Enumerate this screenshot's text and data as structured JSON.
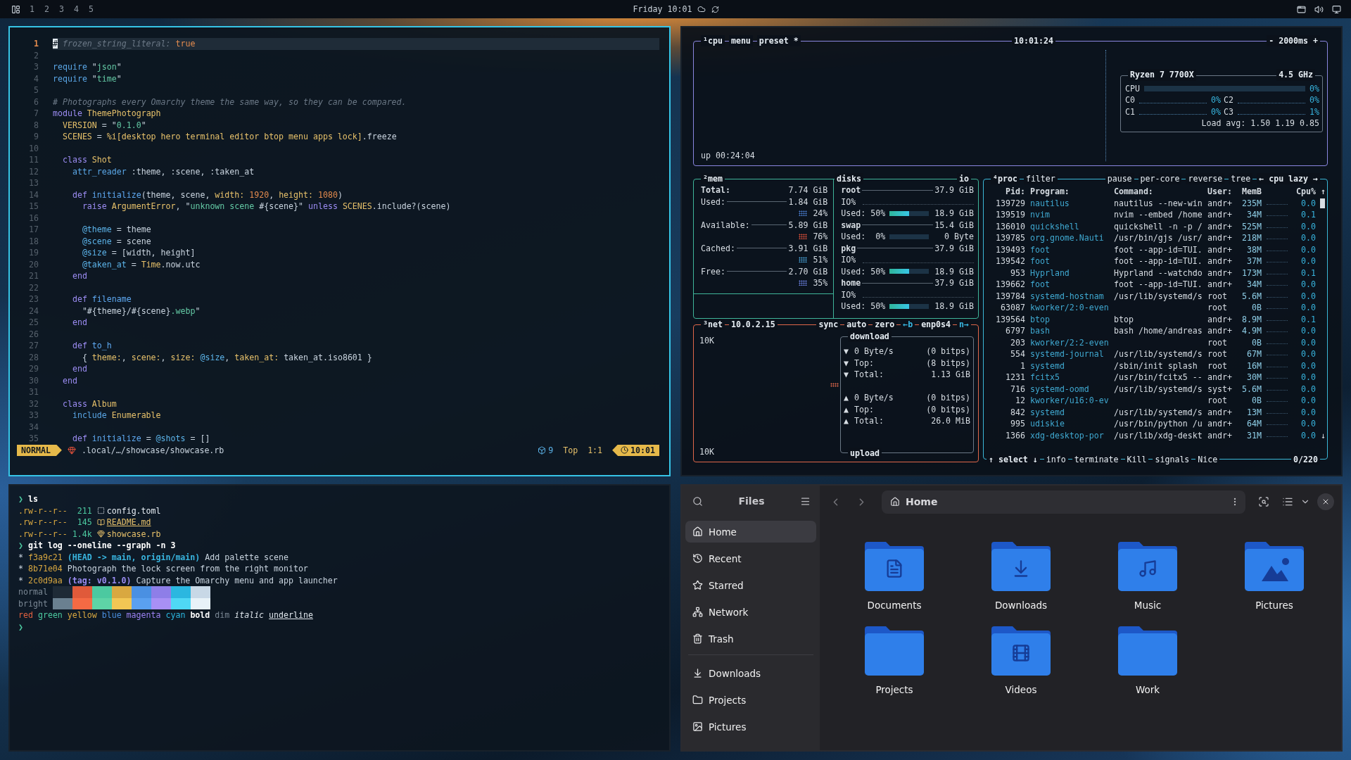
{
  "topbar": {
    "workspaces": [
      "1",
      "2",
      "3",
      "4",
      "5"
    ],
    "clock": "Friday 10:01"
  },
  "editor": {
    "lines": [
      {
        "number": "1",
        "current": true,
        "code": [
          {
            "text": "#",
            "kind": "cursor"
          },
          {
            "text": " frozen_string_literal:",
            "kind": "comment"
          },
          {
            "text": " true",
            "kind": "num"
          }
        ]
      },
      {
        "number": "2",
        "current": false
      },
      {
        "number": "3",
        "current": false,
        "code": [
          {
            "text": "require",
            "kind": "call"
          },
          {
            "text": " \"",
            "kind": "plain"
          },
          {
            "text": "json",
            "kind": "str"
          },
          {
            "text": "\"",
            "kind": "plain"
          }
        ]
      },
      {
        "number": "4",
        "current": false,
        "code": [
          {
            "text": "require",
            "kind": "call"
          },
          {
            "text": " \"",
            "kind": "plain"
          },
          {
            "text": "time",
            "kind": "str"
          },
          {
            "text": "\"",
            "kind": "plain"
          }
        ]
      },
      {
        "number": "5",
        "current": false
      },
      {
        "number": "6",
        "current": false,
        "code": [
          {
            "text": "# Photographs every Omarchy theme the same way, so they can be compared.",
            "kind": "comment"
          }
        ]
      },
      {
        "number": "7",
        "current": false,
        "code": [
          {
            "text": "module",
            "kind": "kw"
          },
          {
            "text": " ThemePhotograph",
            "kind": "const"
          }
        ]
      },
      {
        "number": "8",
        "current": false,
        "code": [
          {
            "text": "  VERSION",
            "kind": "const"
          },
          {
            "text": " = \"",
            "kind": "plain"
          },
          {
            "text": "0.1.0",
            "kind": "str"
          },
          {
            "text": "\"",
            "kind": "plain"
          }
        ]
      },
      {
        "number": "9",
        "current": false,
        "code": [
          {
            "text": "  SCENES",
            "kind": "const"
          },
          {
            "text": " = ",
            "kind": "plain"
          },
          {
            "text": "%i[desktop hero terminal editor btop menu apps lock]",
            "kind": "const"
          },
          {
            "text": ".freeze",
            "kind": "plain"
          }
        ]
      },
      {
        "number": "10",
        "current": false
      },
      {
        "number": "11",
        "current": false,
        "code": [
          {
            "text": "  class",
            "kind": "kw"
          },
          {
            "text": " Shot",
            "kind": "const"
          }
        ]
      },
      {
        "number": "12",
        "current": false,
        "code": [
          {
            "text": "    attr_reader",
            "kind": "call"
          },
          {
            "text": " :theme, :scene, :taken_at",
            "kind": "plain"
          }
        ]
      },
      {
        "number": "13",
        "current": false
      },
      {
        "number": "14",
        "current": false,
        "code": [
          {
            "text": "    def",
            "kind": "kw"
          },
          {
            "text": " initialize",
            "kind": "fn"
          },
          {
            "text": "(theme, scene, ",
            "kind": "plain"
          },
          {
            "text": "width:",
            "kind": "const"
          },
          {
            "text": " 1920",
            "kind": "num"
          },
          {
            "text": ", ",
            "kind": "plain"
          },
          {
            "text": "height:",
            "kind": "const"
          },
          {
            "text": " 1080",
            "kind": "num"
          },
          {
            "text": ")",
            "kind": "plain"
          }
        ]
      },
      {
        "number": "15",
        "current": false,
        "code": [
          {
            "text": "      raise",
            "kind": "kw"
          },
          {
            "text": " ArgumentError",
            "kind": "const"
          },
          {
            "text": ", \"",
            "kind": "plain"
          },
          {
            "text": "unknown scene ",
            "kind": "str"
          },
          {
            "text": "#{scene}\"",
            "kind": "plain"
          },
          {
            "text": " unless",
            "kind": "kw"
          },
          {
            "text": " SCENES",
            "kind": "const"
          },
          {
            "text": ".include?(scene)",
            "kind": "plain"
          }
        ]
      },
      {
        "number": "16",
        "current": false
      },
      {
        "number": "17",
        "current": false,
        "code": [
          {
            "text": "      @theme",
            "kind": "ivar"
          },
          {
            "text": " = theme",
            "kind": "plain"
          }
        ]
      },
      {
        "number": "18",
        "current": false,
        "code": [
          {
            "text": "      @scene",
            "kind": "ivar"
          },
          {
            "text": " = scene",
            "kind": "plain"
          }
        ]
      },
      {
        "number": "19",
        "current": false,
        "code": [
          {
            "text": "      @size",
            "kind": "ivar"
          },
          {
            "text": " = [width, height]",
            "kind": "plain"
          }
        ]
      },
      {
        "number": "20",
        "current": false,
        "code": [
          {
            "text": "      @taken_at",
            "kind": "ivar"
          },
          {
            "text": " = ",
            "kind": "plain"
          },
          {
            "text": "Time",
            "kind": "const"
          },
          {
            "text": ".now.utc",
            "kind": "plain"
          }
        ]
      },
      {
        "number": "21",
        "current": false,
        "code": [
          {
            "text": "    end",
            "kind": "kw"
          }
        ]
      },
      {
        "number": "22",
        "current": false
      },
      {
        "number": "23",
        "current": false,
        "code": [
          {
            "text": "    def",
            "kind": "kw"
          },
          {
            "text": " filename",
            "kind": "fn"
          }
        ]
      },
      {
        "number": "24",
        "current": false,
        "code": [
          {
            "text": "      \"#{theme}/#{scene}",
            "kind": "plain"
          },
          {
            "text": ".webp",
            "kind": "str"
          },
          {
            "text": "\"",
            "kind": "plain"
          }
        ]
      },
      {
        "number": "25",
        "current": false,
        "code": [
          {
            "text": "    end",
            "kind": "kw"
          }
        ]
      },
      {
        "number": "26",
        "current": false
      },
      {
        "number": "27",
        "current": false,
        "code": [
          {
            "text": "    def",
            "kind": "kw"
          },
          {
            "text": " to_h",
            "kind": "fn"
          }
        ]
      },
      {
        "number": "28",
        "current": false,
        "code": [
          {
            "text": "      { ",
            "kind": "plain"
          },
          {
            "text": "theme:",
            "kind": "const"
          },
          {
            "text": ", ",
            "kind": "plain"
          },
          {
            "text": "scene:",
            "kind": "const"
          },
          {
            "text": ", ",
            "kind": "plain"
          },
          {
            "text": "size:",
            "kind": "const"
          },
          {
            "text": " @size",
            "kind": "ivar"
          },
          {
            "text": ", ",
            "kind": "plain"
          },
          {
            "text": "taken_at:",
            "kind": "const"
          },
          {
            "text": " taken_at.iso8601 }",
            "kind": "plain"
          }
        ]
      },
      {
        "number": "29",
        "current": false,
        "code": [
          {
            "text": "    end",
            "kind": "kw"
          }
        ]
      },
      {
        "number": "30",
        "current": false,
        "code": [
          {
            "text": "  end",
            "kind": "kw"
          }
        ]
      },
      {
        "number": "31",
        "current": false
      },
      {
        "number": "32",
        "current": false,
        "code": [
          {
            "text": "  class",
            "kind": "kw"
          },
          {
            "text": " Album",
            "kind": "const"
          }
        ]
      },
      {
        "number": "33",
        "current": false,
        "code": [
          {
            "text": "    include",
            "kind": "call"
          },
          {
            "text": " Enumerable",
            "kind": "const"
          }
        ]
      },
      {
        "number": "34",
        "current": false
      },
      {
        "number": "35",
        "current": false,
        "code": [
          {
            "text": "    def",
            "kind": "kw"
          },
          {
            "text": " initialize",
            "kind": "fn"
          },
          {
            "text": " = ",
            "kind": "plain"
          },
          {
            "text": "@shots",
            "kind": "ivar"
          },
          {
            "text": " = []",
            "kind": "plain"
          }
        ]
      }
    ],
    "status": {
      "mode": "NORMAL",
      "path": ".local/…/showcase/showcase.rb",
      "diagnostics": "9",
      "position": "Top",
      "cursor": "1:1",
      "time": "10:01"
    }
  },
  "btop": {
    "cpu": {
      "titles": [
        "¹cpu",
        "menu",
        "preset *"
      ],
      "clock": "10:01:24",
      "interval": "- 2000ms +",
      "uptime": "up 00:24:04",
      "model": "Ryzen 7 7700X",
      "frequency": "4.5 GHz",
      "total": {
        "label": "CPU",
        "level": 0,
        "reading": "0%"
      },
      "cores": [
        {
          "label": "C0",
          "reading": "0%"
        },
        {
          "label": "C2",
          "reading": "0%"
        },
        {
          "label": "C1",
          "reading": "0%"
        },
        {
          "label": "C3",
          "reading": "1%"
        }
      ],
      "load": "Load avg: 1.50 1.19 0.85"
    },
    "mem": {
      "title": "²mem",
      "rows": [
        {
          "label": "Total:",
          "value": "7.74 GiB"
        },
        {
          "label": "Used:",
          "value": "1.84 GiB",
          "percent": "24%",
          "color": "#4a7fd4"
        },
        {
          "label": "Available:",
          "value": "5.89 GiB",
          "percent": "76%",
          "color": "#e0503a"
        },
        {
          "label": "Cached:",
          "value": "3.91 GiB",
          "percent": "51%",
          "color": "#4aa8e0"
        },
        {
          "label": "Free:",
          "value": "2.70 GiB",
          "percent": "35%",
          "color": "#6a80e0"
        }
      ]
    },
    "disks": {
      "title": "disks",
      "io_title": "io",
      "items": [
        {
          "name": "root",
          "size": "37.9 GiB",
          "io": "IO%",
          "used_label": "Used: 50%",
          "level": 0.5,
          "used": "18.9 GiB"
        },
        {
          "name": "swap",
          "size": "15.4 GiB",
          "used_label": "Used:  0%",
          "level": 0,
          "used": "0 Byte"
        },
        {
          "name": "pkg",
          "size": "37.9 GiB",
          "io": "IO%",
          "used_label": "Used: 50%",
          "level": 0.5,
          "used": "18.9 GiB"
        },
        {
          "name": "home",
          "size": "37.9 GiB",
          "io": "IO%",
          "used_label": "Used: 50%",
          "level": 0.5,
          "used": "18.9 GiB"
        }
      ]
    },
    "net": {
      "title": "³net",
      "address": "10.0.2.15",
      "toggles": [
        "sync",
        "auto",
        "zero"
      ],
      "interface": [
        "←b",
        "enp0s4",
        "n→"
      ],
      "scale_top": "10K",
      "scale_bottom": "10K",
      "download": {
        "title": "download",
        "rows": [
          {
            "arrow": "▼",
            "label": "0 Byte/s",
            "value": "(0 bitps)"
          },
          {
            "arrow": "▼",
            "label": "Top:",
            "value": "(8 bitps)"
          },
          {
            "arrow": "▼",
            "label": "Total:",
            "value": "1.13 GiB"
          }
        ]
      },
      "upload": {
        "title": "upload",
        "rows": [
          {
            "arrow": "▲",
            "label": "0 Byte/s",
            "value": "(0 bitps)"
          },
          {
            "arrow": "▲",
            "label": "Top:",
            "value": "(0 bitps)"
          },
          {
            "arrow": "▲",
            "label": "Total:",
            "value": "26.0 MiB"
          }
        ]
      }
    },
    "proc": {
      "title": "⁴proc",
      "filter": "filter",
      "options": [
        "pause",
        "per-core",
        "reverse",
        "tree"
      ],
      "sort": "← cpu lazy →",
      "columns": [
        "Pid:",
        "Program:",
        "Command:",
        "User:",
        "MemB",
        "Cpu%"
      ],
      "sort_arrow": "↑",
      "scroll_down": "↓",
      "rows": [
        {
          "pid": "139729",
          "program": "nautilus",
          "command": "nautilus --new-win",
          "user": "andr+",
          "mem": "235M",
          "cpu": "0.0"
        },
        {
          "pid": "139519",
          "program": "nvim",
          "command": "nvim --embed /home",
          "user": "andr+",
          "mem": "34M",
          "cpu": "0.1"
        },
        {
          "pid": "136010",
          "program": "quickshell",
          "command": "quickshell -n -p /",
          "user": "andr+",
          "mem": "525M",
          "cpu": "0.0"
        },
        {
          "pid": "139785",
          "program": "org.gnome.Nauti",
          "command": "/usr/bin/gjs /usr/",
          "user": "andr+",
          "mem": "218M",
          "cpu": "0.0"
        },
        {
          "pid": "139493",
          "program": "foot",
          "command": "foot --app-id=TUI.",
          "user": "andr+",
          "mem": "38M",
          "cpu": "0.0"
        },
        {
          "pid": "139542",
          "program": "foot",
          "command": "foot --app-id=TUI.",
          "user": "andr+",
          "mem": "37M",
          "cpu": "0.0"
        },
        {
          "pid": "953",
          "program": "Hyprland",
          "command": "Hyprland --watchdo",
          "user": "andr+",
          "mem": "173M",
          "cpu": "0.1"
        },
        {
          "pid": "139662",
          "program": "foot",
          "command": "foot --app-id=TUI.",
          "user": "andr+",
          "mem": "34M",
          "cpu": "0.0"
        },
        {
          "pid": "139784",
          "program": "systemd-hostnam",
          "command": "/usr/lib/systemd/s",
          "user": "root",
          "mem": "5.6M",
          "cpu": "0.0"
        },
        {
          "pid": "63087",
          "program": "kworker/2:0-even",
          "user": "root",
          "mem": "0B",
          "cpu": "0.0"
        },
        {
          "pid": "139564",
          "program": "btop",
          "command": "btop",
          "user": "andr+",
          "mem": "8.9M",
          "cpu": "0.1"
        },
        {
          "pid": "6797",
          "program": "bash",
          "command": "bash /home/andreas",
          "user": "andr+",
          "mem": "4.9M",
          "cpu": "0.0"
        },
        {
          "pid": "203",
          "program": "kworker/2:2-even",
          "user": "root",
          "mem": "0B",
          "cpu": "0.0"
        },
        {
          "pid": "554",
          "program": "systemd-journal",
          "command": "/usr/lib/systemd/s",
          "user": "root",
          "mem": "67M",
          "cpu": "0.0"
        },
        {
          "pid": "1",
          "program": "systemd",
          "command": "/sbin/init splash",
          "user": "root",
          "mem": "16M",
          "cpu": "0.0"
        },
        {
          "pid": "1231",
          "program": "fcitx5",
          "command": "/usr/bin/fcitx5 --",
          "user": "andr+",
          "mem": "30M",
          "cpu": "0.0"
        },
        {
          "pid": "716",
          "program": "systemd-oomd",
          "command": "/usr/lib/systemd/s",
          "user": "syst+",
          "mem": "5.6M",
          "cpu": "0.0"
        },
        {
          "pid": "12",
          "program": "kworker/u16:0-ev",
          "user": "root",
          "mem": "0B",
          "cpu": "0.0"
        },
        {
          "pid": "842",
          "program": "systemd",
          "command": "/usr/lib/systemd/s",
          "user": "andr+",
          "mem": "13M",
          "cpu": "0.0"
        },
        {
          "pid": "995",
          "program": "udiskie",
          "command": "/usr/bin/python /u",
          "user": "andr+",
          "mem": "64M",
          "cpu": "0.0"
        },
        {
          "pid": "1366",
          "program": "xdg-desktop-por",
          "command": "/usr/lib/xdg-deskt",
          "user": "andr+",
          "mem": "31M",
          "cpu": "0.0"
        }
      ],
      "footer": [
        "↑ select ↓",
        "info",
        "terminate",
        "Kill",
        "signals",
        "Nice"
      ],
      "count": "0/220"
    }
  },
  "terminal": {
    "lines": [
      {
        "kind": "prompt",
        "symbol": "❯",
        "command": "ls"
      },
      {
        "kind": "file",
        "perm": ".rw-r--r--",
        "size": " 211",
        "entry": {
          "kind": "config",
          "name": "config.toml",
          "underlined": false
        }
      },
      {
        "kind": "file",
        "perm": ".rw-r--r--",
        "size": " 145",
        "entry": {
          "kind": "markdown",
          "name": "README.md",
          "underlined": true
        }
      },
      {
        "kind": "file",
        "perm": ".rw-r--r--",
        "size": "1.4k",
        "entry": {
          "kind": "ruby",
          "name": "showcase.rb",
          "underlined": false
        }
      },
      {
        "kind": "prompt",
        "symbol": "❯",
        "command": "git log --oneline --graph -n 3"
      },
      {
        "kind": "commit",
        "graph": "*",
        "hash": "f3a9c21",
        "refs": {
          "kind": "branch",
          "text": "(HEAD -> main, origin/main)"
        },
        "message": "Add palette scene"
      },
      {
        "kind": "commit",
        "graph": "*",
        "hash": "8b71e04",
        "message": "Photograph the lock screen from the right monitor"
      },
      {
        "kind": "commit",
        "graph": "*",
        "hash": "2c0d9aa",
        "refs": {
          "kind": "tag",
          "text": "(tag: v0.1.0)"
        },
        "message": "Capture the Omarchy menu and app launcher"
      },
      {
        "kind": "palette",
        "label": "normal",
        "swatches": [
          {
            "color": "#1e2a36"
          },
          {
            "color": "#e05a3a"
          },
          {
            "color": "#4cc9a0"
          },
          {
            "color": "#d9a840"
          },
          {
            "color": "#4a90e2"
          },
          {
            "color": "#8e7ee8"
          },
          {
            "color": "#2bb7e0"
          },
          {
            "color": "#c8d8e6"
          }
        ]
      },
      {
        "kind": "palette",
        "label": "bright",
        "swatches": [
          {
            "color": "#6a8090"
          },
          {
            "color": "#f56a44"
          },
          {
            "color": "#5ed4a6"
          },
          {
            "color": "#f2c654"
          },
          {
            "color": "#5aa0f0"
          },
          {
            "color": "#a890f5"
          },
          {
            "color": "#4fd8f5"
          },
          {
            "color": "#e8f2f8"
          }
        ]
      },
      {
        "kind": "styles",
        "words": [
          {
            "text": "red",
            "kind": "red"
          },
          {
            "text": "green",
            "kind": "green"
          },
          {
            "text": "yellow",
            "kind": "yellow"
          },
          {
            "text": "blue",
            "kind": "blue"
          },
          {
            "text": "magenta",
            "kind": "magenta"
          },
          {
            "text": "cyan",
            "kind": "cyan"
          },
          {
            "text": "bold",
            "kind": "bold"
          },
          {
            "text": "dim",
            "kind": "dim"
          },
          {
            "text": "italic",
            "kind": "italic"
          },
          {
            "text": "underline",
            "kind": "underline"
          }
        ]
      },
      {
        "kind": "prompt",
        "symbol": "❯"
      }
    ]
  },
  "files": {
    "title": "Files",
    "path": "Home",
    "places": [
      {
        "label": "Home",
        "kind": "home",
        "selected": true
      },
      {
        "label": "Recent",
        "kind": "recent",
        "selected": false
      },
      {
        "label": "Starred",
        "kind": "star",
        "selected": false
      },
      {
        "label": "Network",
        "kind": "network",
        "selected": false
      },
      {
        "label": "Trash",
        "kind": "trash",
        "selected": false
      }
    ],
    "bookmarks": [
      {
        "label": "Downloads",
        "kind": "download",
        "selected": false
      },
      {
        "label": "Projects",
        "kind": "folder",
        "selected": false
      },
      {
        "label": "Pictures",
        "kind": "image",
        "selected": false
      }
    ],
    "folders": [
      {
        "label": "Documents",
        "kind": "document"
      },
      {
        "label": "Downloads",
        "kind": "download"
      },
      {
        "label": "Music",
        "kind": "music"
      },
      {
        "label": "Pictures",
        "kind": "picture"
      },
      {
        "label": "Projects",
        "kind": "plain"
      },
      {
        "label": "Videos",
        "kind": "video"
      },
      {
        "label": "Work",
        "kind": "plain"
      }
    ]
  }
}
